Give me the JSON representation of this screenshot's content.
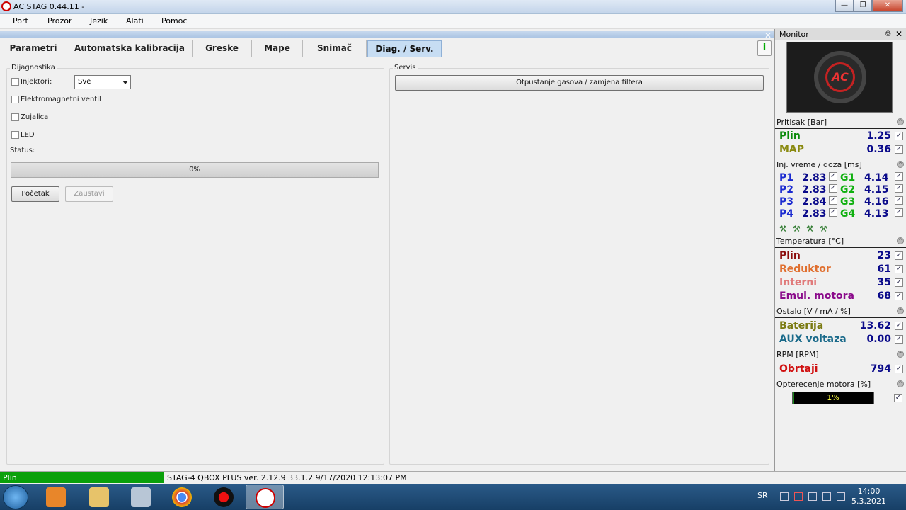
{
  "window": {
    "title": "AC STAG 0.44.11 -"
  },
  "menu": [
    "Port",
    "Prozor",
    "Jezik",
    "Alati",
    "Pomoc"
  ],
  "tabs": [
    "Parametri",
    "Automatska kalibracija",
    "Greske",
    "Mape",
    "Snimač",
    "Diag. / Serv."
  ],
  "diag": {
    "group_title": "Dijagnostika",
    "injektori_label": "Injektori:",
    "injektori_value": "Sve",
    "ventil_label": "Elektromagnetni ventil",
    "zujalica_label": "Zujalica",
    "led_label": "LED",
    "status_label": "Status:",
    "progress_text": "0%",
    "progress": 0,
    "start_button": "Početak",
    "stop_button": "Zaustavi"
  },
  "servis": {
    "group_title": "Servis",
    "button": "Otpustanje gasova / zamjena filtera"
  },
  "monitor": {
    "title": "Monitor",
    "pritisak": {
      "header": "Pritisak [Bar]",
      "plin_label": "Plin",
      "plin_value": "1.25",
      "map_label": "MAP",
      "map_value": "0.36"
    },
    "inj": {
      "header": "Inj. vreme / doza [ms]",
      "rows": [
        {
          "p": "P1",
          "pv": "2.83",
          "g": "G1",
          "gv": "4.14"
        },
        {
          "p": "P2",
          "pv": "2.83",
          "g": "G2",
          "gv": "4.15"
        },
        {
          "p": "P3",
          "pv": "2.84",
          "g": "G3",
          "gv": "4.16"
        },
        {
          "p": "P4",
          "pv": "2.83",
          "g": "G4",
          "gv": "4.13"
        }
      ]
    },
    "temperatura": {
      "header": "Temperatura [°C]",
      "plin_label": "Plin",
      "plin_value": "23",
      "reduktor_label": "Reduktor",
      "reduktor_value": "61",
      "interni_label": "Interni",
      "interni_value": "35",
      "emul_label": "Emul. motora",
      "emul_value": "68"
    },
    "ostalo": {
      "header": "Ostalo [V / mA / %]",
      "baterija_label": "Baterija",
      "baterija_value": "13.62",
      "aux_label": "AUX voltaza",
      "aux_value": "0.00"
    },
    "rpm": {
      "header": "RPM [RPM]",
      "obrtaji_label": "Obrtaji",
      "obrtaji_value": "794"
    },
    "opterecenje": {
      "header": "Opterecenje motora [%]",
      "value_text": "1%",
      "value": 1
    }
  },
  "statusbar": {
    "mode": "Plin",
    "info": "STAG-4 QBOX PLUS  ver. 2.12.9  33.1.2  9/17/2020 12:13:07 PM"
  },
  "taskbar": {
    "language": "SR",
    "time": "14:00",
    "date": "5.3.2021"
  },
  "colors": {
    "plin_pressure": "#0a8a0a",
    "map": "#8a8a10",
    "temp_plin": "#8a0a0a",
    "reduktor": "#e07030",
    "interni": "#e07a7a",
    "emul": "#8a0a8a",
    "baterija": "#7a7a10",
    "aux": "#1a6a8a",
    "obrtaji": "#d01010",
    "p_inj": "#1a2ad0",
    "g_inj": "#10b010"
  }
}
